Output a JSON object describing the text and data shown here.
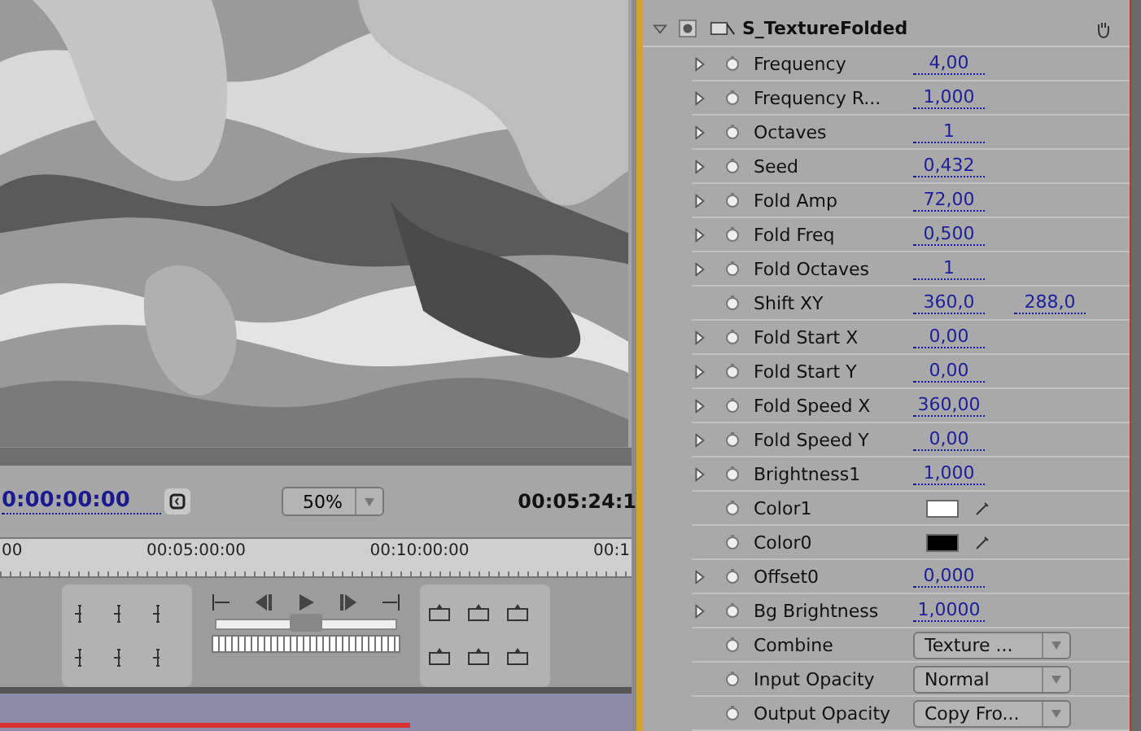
{
  "monitor": {
    "current_time": "0:00:00:00",
    "zoom": "50%",
    "duration": "00:05:24:1",
    "ruler_labels": [
      "00",
      "00:05:00:00",
      "00:10:00:00",
      "00:1"
    ],
    "shuttle": {
      "level": 0.5
    },
    "work_area": {
      "level": 0.65
    }
  },
  "effect": {
    "name": "S_TextureFolded",
    "expanded": true,
    "properties": [
      {
        "kind": "number",
        "name": "Frequency",
        "twirl": true,
        "value": "4,00"
      },
      {
        "kind": "number",
        "name": "Frequency R...",
        "twirl": true,
        "value": "1,000"
      },
      {
        "kind": "number",
        "name": "Octaves",
        "twirl": true,
        "value": "1"
      },
      {
        "kind": "number",
        "name": "Seed",
        "twirl": true,
        "value": "0,432"
      },
      {
        "kind": "number",
        "name": "Fold Amp",
        "twirl": true,
        "value": "72,00"
      },
      {
        "kind": "number",
        "name": "Fold Freq",
        "twirl": true,
        "value": "0,500"
      },
      {
        "kind": "number",
        "name": "Fold Octaves",
        "twirl": true,
        "value": "1"
      },
      {
        "kind": "pair",
        "name": "Shift XY",
        "twirl": false,
        "value": "360,0",
        "value2": "288,0"
      },
      {
        "kind": "number",
        "name": "Fold Start X",
        "twirl": true,
        "value": "0,00"
      },
      {
        "kind": "number",
        "name": "Fold Start Y",
        "twirl": true,
        "value": "0,00"
      },
      {
        "kind": "number",
        "name": "Fold Speed X",
        "twirl": true,
        "value": "360,00"
      },
      {
        "kind": "number",
        "name": "Fold Speed Y",
        "twirl": true,
        "value": "0,00"
      },
      {
        "kind": "number",
        "name": "Brightness1",
        "twirl": true,
        "value": "1,000"
      },
      {
        "kind": "color",
        "name": "Color1",
        "twirl": false,
        "color": "#ffffff"
      },
      {
        "kind": "color",
        "name": "Color0",
        "twirl": false,
        "color": "#000000"
      },
      {
        "kind": "number",
        "name": "Offset0",
        "twirl": true,
        "value": "0,000"
      },
      {
        "kind": "number",
        "name": "Bg Brightness",
        "twirl": true,
        "value": "1,0000"
      },
      {
        "kind": "dropdown",
        "name": "Combine",
        "twirl": false,
        "value": "Texture ..."
      },
      {
        "kind": "dropdown",
        "name": "Input Opacity",
        "twirl": false,
        "value": "Normal"
      },
      {
        "kind": "dropdown",
        "name": "Output Opacity",
        "twirl": false,
        "value": "Copy Fro..."
      }
    ]
  }
}
